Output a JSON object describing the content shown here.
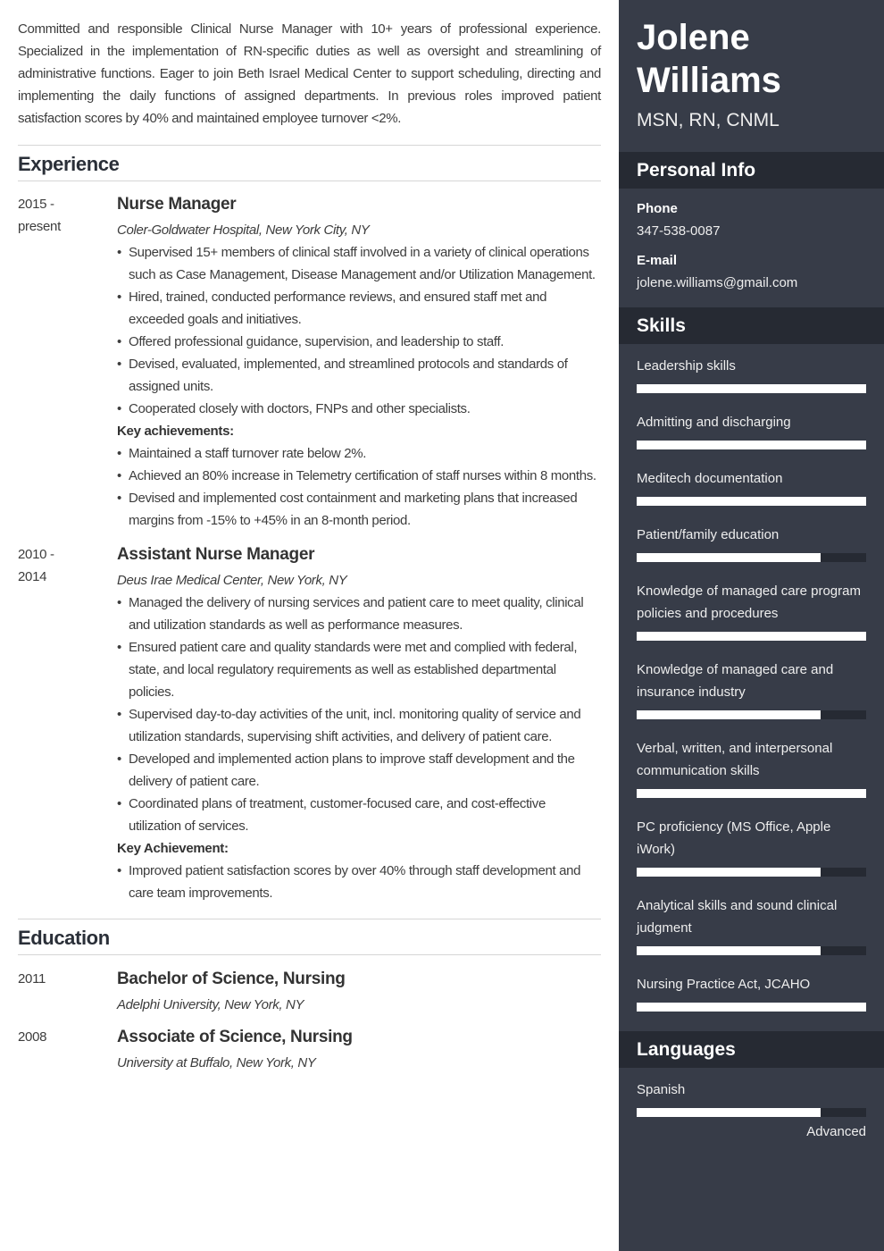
{
  "summary": "Committed and responsible Clinical Nurse Manager with 10+ years of professional experience. Specialized in the implementation of RN-specific duties as well as oversight and streamlining of administrative functions. Eager to join Beth Israel Medical Center to support scheduling, directing and implementing the daily functions of assigned departments. In previous roles improved patient satisfaction scores by 40% and maintained employee turnover <2%.",
  "experience": {
    "heading": "Experience",
    "entries": [
      {
        "date_line1": "2015 -",
        "date_line2": "present",
        "title": "Nurse Manager",
        "org": "Coler-Goldwater Hospital, New York City, NY",
        "bullets": [
          "Supervised 15+ members of clinical staff involved in a variety of clinical operations such as Case Management, Disease Management and/or Utilization Management.",
          "Hired, trained, conducted performance reviews, and ensured staff met and exceeded goals and initiatives.",
          "Offered professional guidance, supervision, and leadership to staff.",
          "Devised, evaluated, implemented, and streamlined protocols and standards of assigned units.",
          "Cooperated closely with doctors, FNPs and other specialists."
        ],
        "key_label": "Key achievements:",
        "key_bullets": [
          "Maintained a staff turnover rate below 2%.",
          "Achieved an 80% increase in Telemetry certification of staff nurses within 8 months.",
          "Devised and implemented cost containment and marketing plans that increased margins from -15% to +45% in an 8-month period."
        ]
      },
      {
        "date_line1": "2010 -",
        "date_line2": "2014",
        "title": "Assistant Nurse Manager",
        "org": "Deus Irae Medical Center, New York, NY",
        "bullets": [
          "Managed the delivery of nursing services and patient care to meet quality, clinical and utilization standards as well as performance measures.",
          "Ensured patient care and quality standards were met and complied with federal, state, and local regulatory requirements as well as established departmental policies.",
          "Supervised day-to-day activities of the unit, incl. monitoring quality of service and utilization standards, supervising shift activities, and delivery of patient care.",
          "Developed and implemented action plans to improve staff development and the delivery of patient care.",
          "Coordinated plans of treatment, customer-focused care, and cost-effective utilization of services."
        ],
        "key_label": "Key Achievement:",
        "key_bullets": [
          "Improved patient satisfaction scores by over 40% through staff development and care team improvements."
        ]
      }
    ]
  },
  "education": {
    "heading": "Education",
    "entries": [
      {
        "date": "2011",
        "title": "Bachelor of Science, Nursing",
        "org": "Adelphi University, New York, NY"
      },
      {
        "date": "2008",
        "title": "Associate of Science, Nursing",
        "org": "University at Buffalo, New York, NY"
      }
    ]
  },
  "sidebar": {
    "name_first": "Jolene",
    "name_last": "Williams",
    "credentials": "MSN, RN, CNML",
    "personal_info": {
      "heading": "Personal Info",
      "phone_label": "Phone",
      "phone": "347-538-0087",
      "email_label": "E-mail",
      "email": "jolene.williams@gmail.com"
    },
    "skills": {
      "heading": "Skills",
      "items": [
        {
          "label": "Leadership skills",
          "level": 100
        },
        {
          "label": "Admitting and discharging",
          "level": 100
        },
        {
          "label": "Meditech documentation",
          "level": 100
        },
        {
          "label": "Patient/family education",
          "level": 80
        },
        {
          "label": "Knowledge of managed care program policies and procedures",
          "level": 100
        },
        {
          "label": "Knowledge of managed care and insurance industry",
          "level": 80
        },
        {
          "label": "Verbal, written, and interpersonal communication skills",
          "level": 100
        },
        {
          "label": "PC proficiency (MS Office, Apple iWork)",
          "level": 80
        },
        {
          "label": "Analytical skills and sound clinical judgment",
          "level": 80
        },
        {
          "label": "Nursing Practice Act, JCAHO",
          "level": 100
        }
      ]
    },
    "languages": {
      "heading": "Languages",
      "items": [
        {
          "label": "Spanish",
          "level": 80,
          "level_text": "Advanced"
        }
      ]
    }
  },
  "colors": {
    "sidebar_bg": "#373c48",
    "sidebar_heading_bg": "#262a33",
    "bar_fill": "#ffffff",
    "bar_track": "#262a33",
    "text_main": "#3d3d3d"
  }
}
